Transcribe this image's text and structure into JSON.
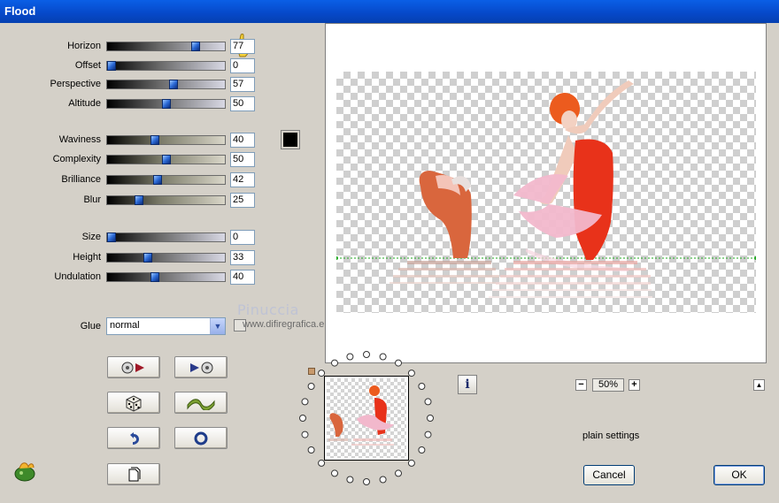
{
  "window": {
    "title": "Flood"
  },
  "sliders": [
    {
      "id": "horizon",
      "label": "Horizon",
      "value": "77",
      "fraction": 0.77
    },
    {
      "id": "offset",
      "label": "Offset",
      "value": "0",
      "fraction": 0.0
    },
    {
      "id": "perspective",
      "label": "Perspective",
      "value": "57",
      "fraction": 0.57
    },
    {
      "id": "altitude",
      "label": "Altitude",
      "value": "50",
      "fraction": 0.5
    },
    {
      "id": "waviness",
      "label": "Waviness",
      "value": "40",
      "fraction": 0.4
    },
    {
      "id": "complexity",
      "label": "Complexity",
      "value": "50",
      "fraction": 0.5
    },
    {
      "id": "brilliance",
      "label": "Brilliance",
      "value": "42",
      "fraction": 0.42
    },
    {
      "id": "blur",
      "label": "Blur",
      "value": "25",
      "fraction": 0.25
    },
    {
      "id": "size",
      "label": "Size",
      "value": "0",
      "fraction": 0.0
    },
    {
      "id": "height",
      "label": "Height",
      "value": "33",
      "fraction": 0.33
    },
    {
      "id": "undulation",
      "label": "Undulation",
      "value": "40",
      "fraction": 0.4
    }
  ],
  "color": {
    "swatch": "#000000"
  },
  "glue": {
    "label": "Glue",
    "value": "normal"
  },
  "watermark": {
    "name": "Pinuccia",
    "site": "www.difiregrafica.eu"
  },
  "zoom": {
    "value": "50%",
    "minus": "−",
    "plus": "+"
  },
  "status": {
    "text": "plain settings"
  },
  "buttons": {
    "cancel": "Cancel",
    "ok": "OK"
  },
  "icons": {
    "hand": "pointing-hand-icon",
    "info": "info-icon",
    "logo": "plugin-logo-icon"
  },
  "colors": {
    "titlebar": "#0648c8",
    "dialog": "#d4d0c8",
    "accent": "#2c6ad6"
  }
}
